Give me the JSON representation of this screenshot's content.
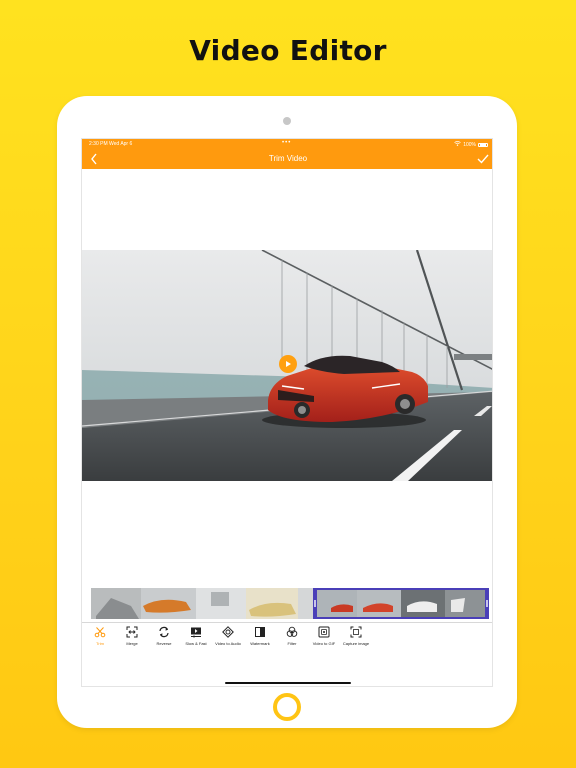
{
  "headline": "Video Editor",
  "status_bar": {
    "time_date": "2:30 PM  Wed Apr 6",
    "dots": "•••",
    "battery": "100%",
    "icons": [
      "wifi-icon",
      "battery-icon"
    ]
  },
  "nav_bar": {
    "title": "Trim Video",
    "left_icon": "chevron-left-icon",
    "right_icon": "check-icon"
  },
  "colors": {
    "background": "#FFDA1C",
    "accent": "#FF9A0E",
    "home_button": "#FFC414"
  },
  "toolbar": {
    "items": [
      {
        "label": "Trim",
        "icon": "scissors-icon",
        "active": true
      },
      {
        "label": "Merge",
        "icon": "merge-icon",
        "active": false
      },
      {
        "label": "Reverse",
        "icon": "reverse-icon",
        "active": false
      },
      {
        "label": "Slow & Fast",
        "icon": "speed-icon",
        "active": false
      },
      {
        "label": "Video to Audio",
        "icon": "audio-icon",
        "active": false
      },
      {
        "label": "Watermark",
        "icon": "watermark-icon",
        "active": false
      },
      {
        "label": "Filter",
        "icon": "filter-icon",
        "active": false
      },
      {
        "label": "Video to GIF",
        "icon": "gif-icon",
        "active": false
      },
      {
        "label": "Capture image",
        "icon": "capture-icon",
        "active": false
      }
    ]
  }
}
